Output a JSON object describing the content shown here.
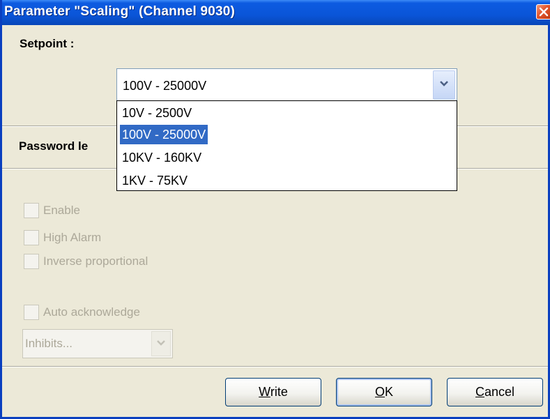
{
  "window": {
    "title": "Parameter \"Scaling\" (Channel 9030)"
  },
  "setpoint": {
    "label": "Setpoint :",
    "selected_value": "100V - 25000V",
    "options": [
      "10V - 2500V",
      "100V - 25000V",
      "10KV - 160KV",
      "1KV - 75KV"
    ],
    "highlighted_index": 1
  },
  "password": {
    "label_visible": "Password le"
  },
  "checkboxes": {
    "enable": "Enable",
    "high_alarm": "High Alarm",
    "inverse_proportional": "Inverse proportional",
    "auto_acknowledge": "Auto acknowledge"
  },
  "inhibits": {
    "value": "Inhibits..."
  },
  "buttons": {
    "write": {
      "first": "W",
      "rest": "rite"
    },
    "ok": {
      "first": "O",
      "rest": "K"
    },
    "cancel": {
      "first": "C",
      "rest": "ancel"
    }
  },
  "colors": {
    "titlebar": "#0a55d8",
    "selection": "#316ac5",
    "dialog_bg": "#ece9d8",
    "disabled_text": "#aca899"
  },
  "icons": {
    "close": "close-icon",
    "combo_arrow": "chevron-down-icon"
  }
}
